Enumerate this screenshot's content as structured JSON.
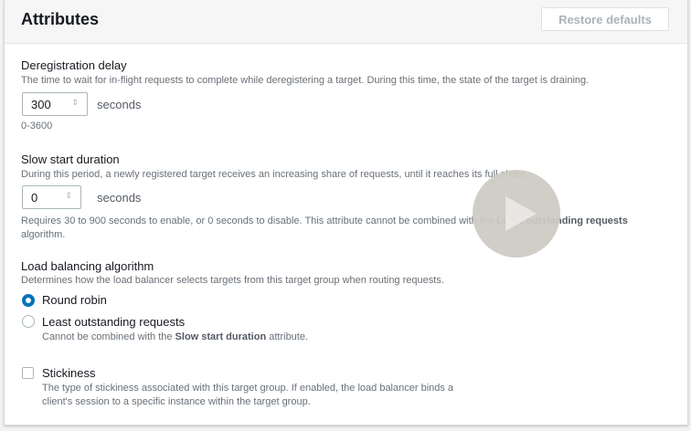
{
  "header": {
    "title": "Attributes",
    "restore_label": "Restore defaults"
  },
  "dereg": {
    "label": "Deregistration delay",
    "desc": "The time to wait for in-flight requests to complete while deregistering a target. During this time, the state of the target is draining.",
    "value": "300",
    "unit": "seconds",
    "range": "0-3600"
  },
  "slow": {
    "label": "Slow start duration",
    "desc": "During this period, a newly registered target receives an increasing share of requests, until it reaches its full share.",
    "value": "0",
    "unit": "seconds",
    "note1": "Requires 30 to 900 seconds to enable, or 0 seconds to disable. This attribute cannot be combined with the ",
    "note_bold": "Least outstanding requests",
    "note2": "algorithm."
  },
  "lb": {
    "label": "Load balancing algorithm",
    "desc": "Determines how the load balancer selects targets from this target group when routing requests.",
    "options": [
      {
        "label": "Round robin",
        "selected": true
      },
      {
        "label": "Least outstanding requests",
        "selected": false,
        "hint1": "Cannot be combined with the ",
        "hint_bold": "Slow start duration",
        "hint2": " attribute."
      }
    ]
  },
  "stickiness": {
    "label": "Stickiness",
    "checked": false,
    "desc1": "The type of stickiness associated with this target group. If enabled, the load balancer binds a",
    "desc2": "client's session to a specific instance within the target group."
  }
}
